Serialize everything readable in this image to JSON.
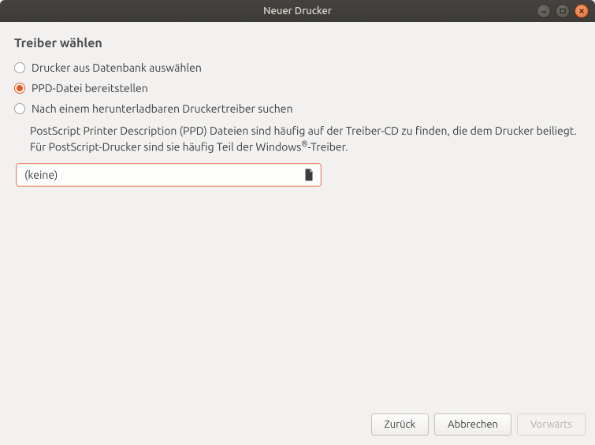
{
  "window": {
    "title": "Neuer Drucker"
  },
  "heading": "Treiber wählen",
  "options": {
    "db": "Drucker aus Datenbank auswählen",
    "ppd": "PPD-Datei bereitstellen",
    "download": "Nach einem herunterladbaren Druckertreiber suchen"
  },
  "description": {
    "part1": "PostScript Printer Description (PPD) Dateien sind häufig auf der Treiber-CD zu finden, die dem Drucker beiliegt. Für PostScript-Drucker sind sie häufig Teil der Windows",
    "sup": "®",
    "part2": "-Treiber."
  },
  "file_picker": {
    "value": "(keine)"
  },
  "buttons": {
    "back": "Zurück",
    "cancel": "Abbrechen",
    "forward": "Vorwärts"
  }
}
